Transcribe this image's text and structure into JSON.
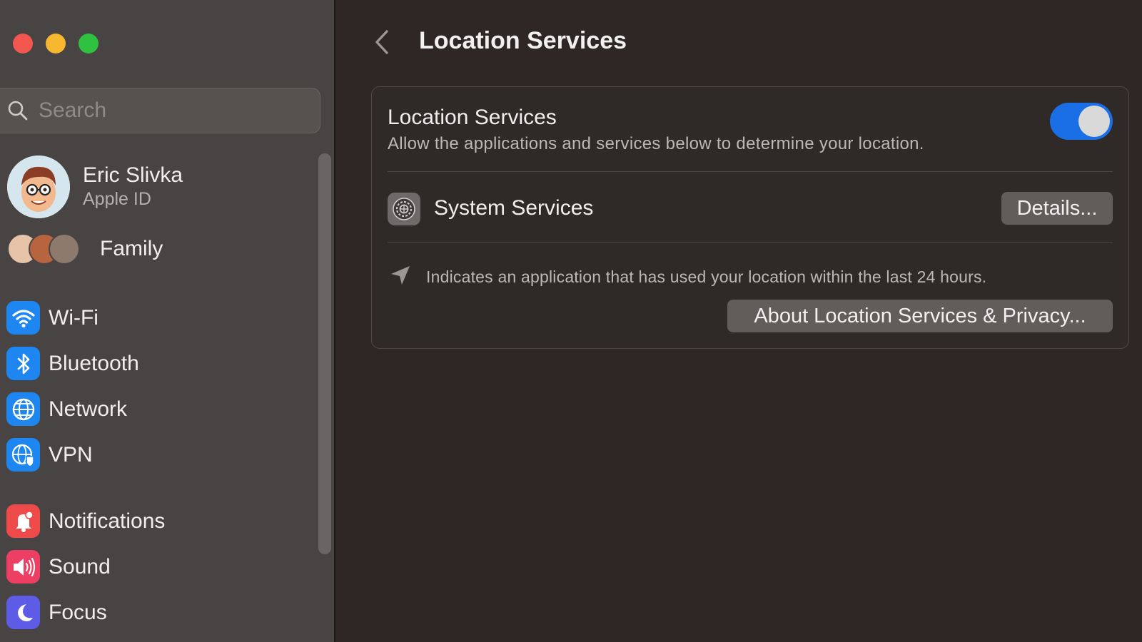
{
  "window": {
    "traffic_lights": {
      "close": "#f2564f",
      "minimize": "#f7b731",
      "zoom": "#2fc241"
    }
  },
  "sidebar": {
    "search": {
      "placeholder": "Search",
      "value": ""
    },
    "profile": {
      "name": "Eric Slivka",
      "subtitle": "Apple ID"
    },
    "family": {
      "label": "Family"
    },
    "items": [
      {
        "label": "Wi-Fi",
        "icon": "wifi-icon",
        "color": "#1e86f0"
      },
      {
        "label": "Bluetooth",
        "icon": "bluetooth-icon",
        "color": "#1e86f0"
      },
      {
        "label": "Network",
        "icon": "globe-icon",
        "color": "#1e86f0"
      },
      {
        "label": "VPN",
        "icon": "vpn-globe-icon",
        "color": "#1e86f0"
      },
      {
        "label": "Notifications",
        "icon": "bell-icon",
        "color": "#ef4a4a"
      },
      {
        "label": "Sound",
        "icon": "speaker-icon",
        "color": "#ec3f63"
      },
      {
        "label": "Focus",
        "icon": "moon-icon",
        "color": "#5e5ce6"
      }
    ]
  },
  "main": {
    "title": "Location Services",
    "location_services": {
      "title": "Location Services",
      "description": "Allow the applications and services below to determine your location.",
      "enabled": true,
      "toggle_color": "#1a6fe6"
    },
    "system_services": {
      "label": "System Services",
      "button": "Details..."
    },
    "info": {
      "text": "Indicates an application that has used your location within the last 24 hours."
    },
    "about_button": "About Location Services & Privacy..."
  }
}
